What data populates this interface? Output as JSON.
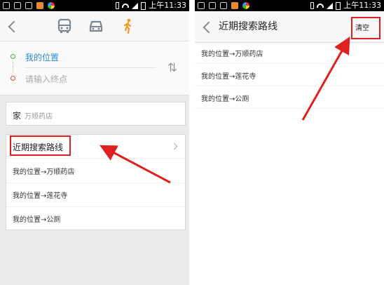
{
  "status_bar": {
    "time": "上午11:33"
  },
  "left_screen": {
    "route_input": {
      "start": "我的位置",
      "end_placeholder": "请输入终点",
      "swap_glyph": "⇅"
    },
    "home": {
      "label": "家",
      "value": "万顺药店"
    },
    "recent": {
      "header": "近期搜索路线",
      "items": [
        {
          "label": "我的位置→万顺药店"
        },
        {
          "label": "我的位置→莲花寺"
        },
        {
          "label": "我的位置→公厕"
        }
      ]
    },
    "active_mode": "walk"
  },
  "right_screen": {
    "title": "近期搜索路线",
    "clear_label": "清空",
    "items": [
      {
        "label": "我的位置→万顺药店"
      },
      {
        "label": "我的位置→莲花寺"
      },
      {
        "label": "我的位置→公厕"
      }
    ]
  },
  "icons": [
    "back-icon",
    "bus-icon",
    "car-icon",
    "walk-icon",
    "swap-icon",
    "chevron-right-icon"
  ],
  "colors": {
    "accent": "#f19a1f",
    "highlight": "#e02020",
    "link": "#2a8ad4"
  }
}
